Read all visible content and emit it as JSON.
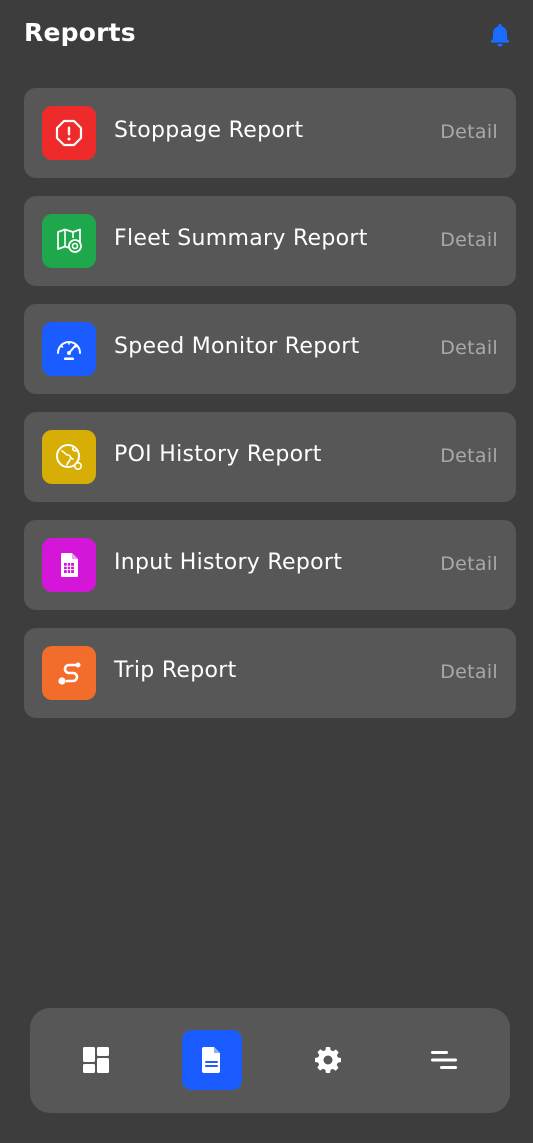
{
  "header": {
    "title": "Reports",
    "bell_icon": "bell-icon",
    "bell_color": "#1a6bff"
  },
  "reports": [
    {
      "label": "Stoppage Report",
      "detail": "Detail",
      "icon": "stop-octagon-icon",
      "color": "#ef2a2a"
    },
    {
      "label": "Fleet Summary Report",
      "detail": "Detail",
      "icon": "map-pin-icon",
      "color": "#1fa84b"
    },
    {
      "label": "Speed Monitor Report",
      "detail": "Detail",
      "icon": "speedometer-icon",
      "color": "#1a5cff"
    },
    {
      "label": "POI History Report",
      "detail": "Detail",
      "icon": "globe-pin-icon",
      "color": "#d6ae06"
    },
    {
      "label": "Input History Report",
      "detail": "Detail",
      "icon": "spreadsheet-icon",
      "color": "#d416d8"
    },
    {
      "label": "Trip Report",
      "detail": "Detail",
      "icon": "route-icon",
      "color": "#f26d2c"
    }
  ],
  "nav": {
    "items": [
      {
        "icon": "dashboard-grid-icon",
        "active": false
      },
      {
        "icon": "document-icon",
        "active": true
      },
      {
        "icon": "gear-icon",
        "active": false
      },
      {
        "icon": "menu-lines-icon",
        "active": false
      }
    ],
    "active_color": "#1a5cff"
  }
}
